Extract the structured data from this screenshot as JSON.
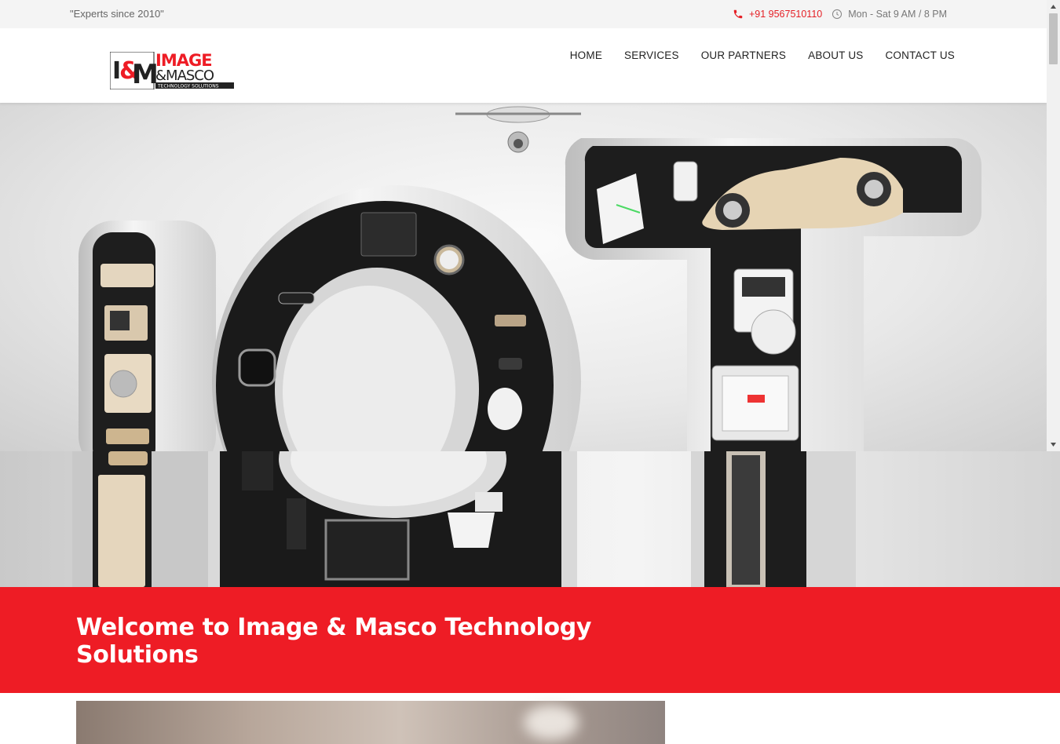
{
  "topbar": {
    "tagline": "\"Experts since 2010\"",
    "phone": "+91 9567510110",
    "hours": "Mon - Sat 9 AM / 8 PM"
  },
  "logo": {
    "initials": "I&M",
    "line1": "IMAGE",
    "line2": "&MASCO",
    "line3": "TECHNOLOGY SOLUTIONS"
  },
  "nav": {
    "items": [
      "HOME",
      "SERVICES",
      "OUR PARTNERS",
      "ABOUT US",
      "CONTACT US"
    ]
  },
  "welcome": {
    "heading": "Welcome to Image & Masco Technology Solutions"
  },
  "colors": {
    "brand_red": "#ee1c25",
    "topbar_bg": "#f4f4f4"
  },
  "icons": [
    "phone-icon",
    "clock-icon"
  ]
}
